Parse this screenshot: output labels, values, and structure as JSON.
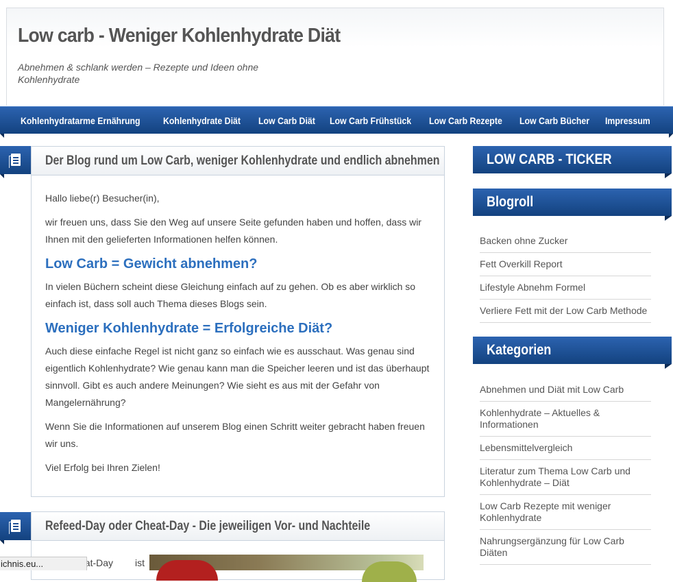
{
  "site": {
    "title": "Low carb - Weniger Kohlenhydrate Diät",
    "description": "Abnehmen & schlank werden – Rezepte und Ideen ohne Kohlenhydrate"
  },
  "nav": {
    "items": [
      {
        "label": "Kohlenhydratarme Ernährung"
      },
      {
        "label": "Kohlenhydrate Diät"
      },
      {
        "label": "Low Carb Diät"
      },
      {
        "label": "Low Carb Frühstück"
      },
      {
        "label": "Low Carb Rezepte"
      },
      {
        "label": "Low Carb Bücher"
      },
      {
        "label": "Impressum"
      }
    ]
  },
  "posts": [
    {
      "title": "Der Blog rund um Low Carb, weniger Kohlenhydrate und endlich abnehmen",
      "icon": "document-icon",
      "p1": "Hallo liebe(r) Besucher(in),",
      "p2": "wir freuen uns, dass Sie den Weg auf unsere Seite gefunden haben und hoffen, dass wir Ihnen mit den gelieferten Informationen helfen können.",
      "h1": "Low Carb = Gewicht abnehmen?",
      "p3": "In vielen Büchern scheint diese Gleichung einfach auf zu gehen. Ob es aber wirklich so einfach ist, dass soll auch Thema dieses Blogs sein.",
      "h2": "Weniger Kohlenhydrate = Erfolgreiche Diät?",
      "p4": "Auch diese einfache Regel ist nicht ganz so einfach wie es ausschaut. Was genau sind eigentlich Kohlenhydrate? Wie genau kann man die Speicher leeren und ist das überhaupt sinnvoll. Gibt es auch andere Meinungen? Wie sieht es aus mit der Gefahr von Mangelernährung?",
      "p5": "Wenn Sie die Informationen auf unserem Blog einen Schritt weiter gebracht haben freuen wir uns.",
      "p6": "Viel Erfolg bei Ihren Zielen!"
    },
    {
      "title": "Refeed-Day oder Cheat-Day - Die jeweiligen Vor- und Nachteile",
      "icon": "document-icon",
      "excerpt_start": "eat-Day",
      "excerpt_word": "ist"
    }
  ],
  "sidebar": {
    "ticker_title": "LOW CARB - TICKER",
    "blogroll_title": "Blogroll",
    "blogroll": [
      "Backen ohne Zucker",
      "Fett Overkill Report",
      "Lifestyle Abnehm Formel",
      "Verliere Fett mit der Low Carb Methode"
    ],
    "categories_title": "Kategorien",
    "categories": [
      "Abnehmen und Diät mit Low Carb",
      "Kohlenhydrate – Aktuelles & Informationen",
      "Lebensmittelvergleich",
      "Literatur zum Thema Low Carb und Kohlenhydrate – Diät",
      "Low Carb Rezepte mit weniger Kohlenhydrate",
      "Nahrungsergänzung für Low Carb Diäten"
    ]
  },
  "status_bar": {
    "text": "ichnis.eu..."
  },
  "colors": {
    "nav_blue": "#1d4f94",
    "heading_blue": "#2c6fbe"
  }
}
